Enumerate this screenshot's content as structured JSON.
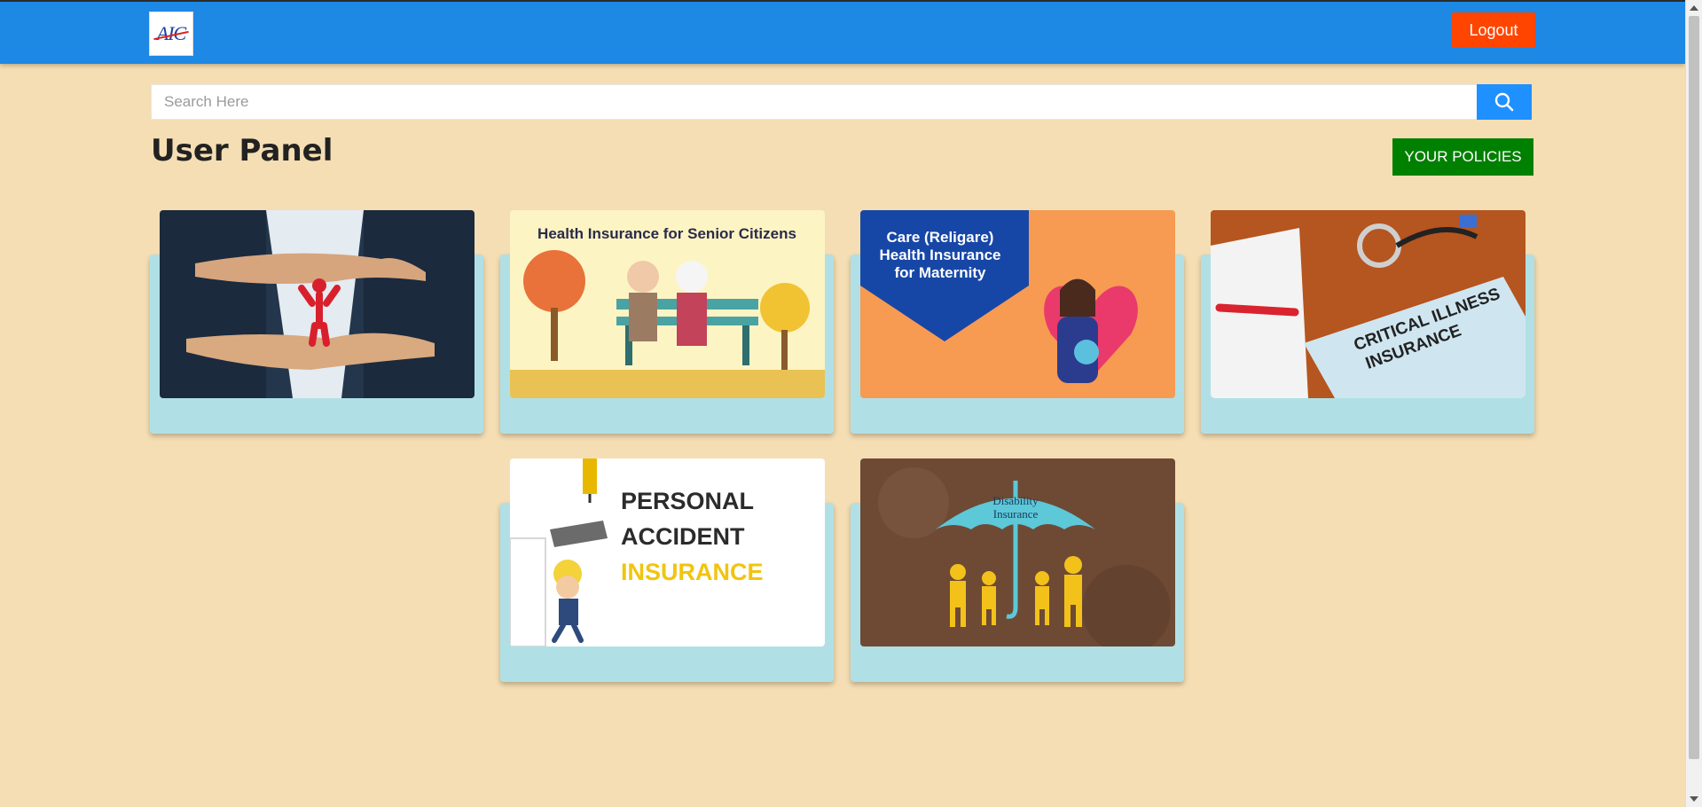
{
  "header": {
    "logo_text": "AIC",
    "logout_label": "Logout"
  },
  "search": {
    "placeholder": "Search Here",
    "icon": "search-icon"
  },
  "page": {
    "title": "User Panel",
    "policies_button": "YOUR POLICIES"
  },
  "cards": [
    {
      "image": "hands-protecting-person",
      "caption": ""
    },
    {
      "image": "senior-citizens-on-bench",
      "caption": "Health Insurance for Senior Citizens"
    },
    {
      "image": "mother-and-baby",
      "caption_lines": [
        "Care (Religare)",
        "Health Insurance",
        "for Maternity"
      ]
    },
    {
      "image": "stethoscope-on-desk",
      "caption_lines": [
        "CRITICAL ILLNESS",
        "INSURANCE"
      ]
    },
    {
      "image": "construction-worker-falling",
      "caption_lines": [
        "PERSONAL",
        "ACCIDENT",
        "INSURANCE"
      ]
    },
    {
      "image": "umbrella-over-family",
      "caption_lines": [
        "Disability",
        "Insurance"
      ]
    }
  ],
  "colors": {
    "navbar": "#1e88e5",
    "background": "#f5deb3",
    "logout": "#ff4500",
    "policies": "#008000",
    "card": "#b0e0e6",
    "search_button": "#1e90ff"
  }
}
